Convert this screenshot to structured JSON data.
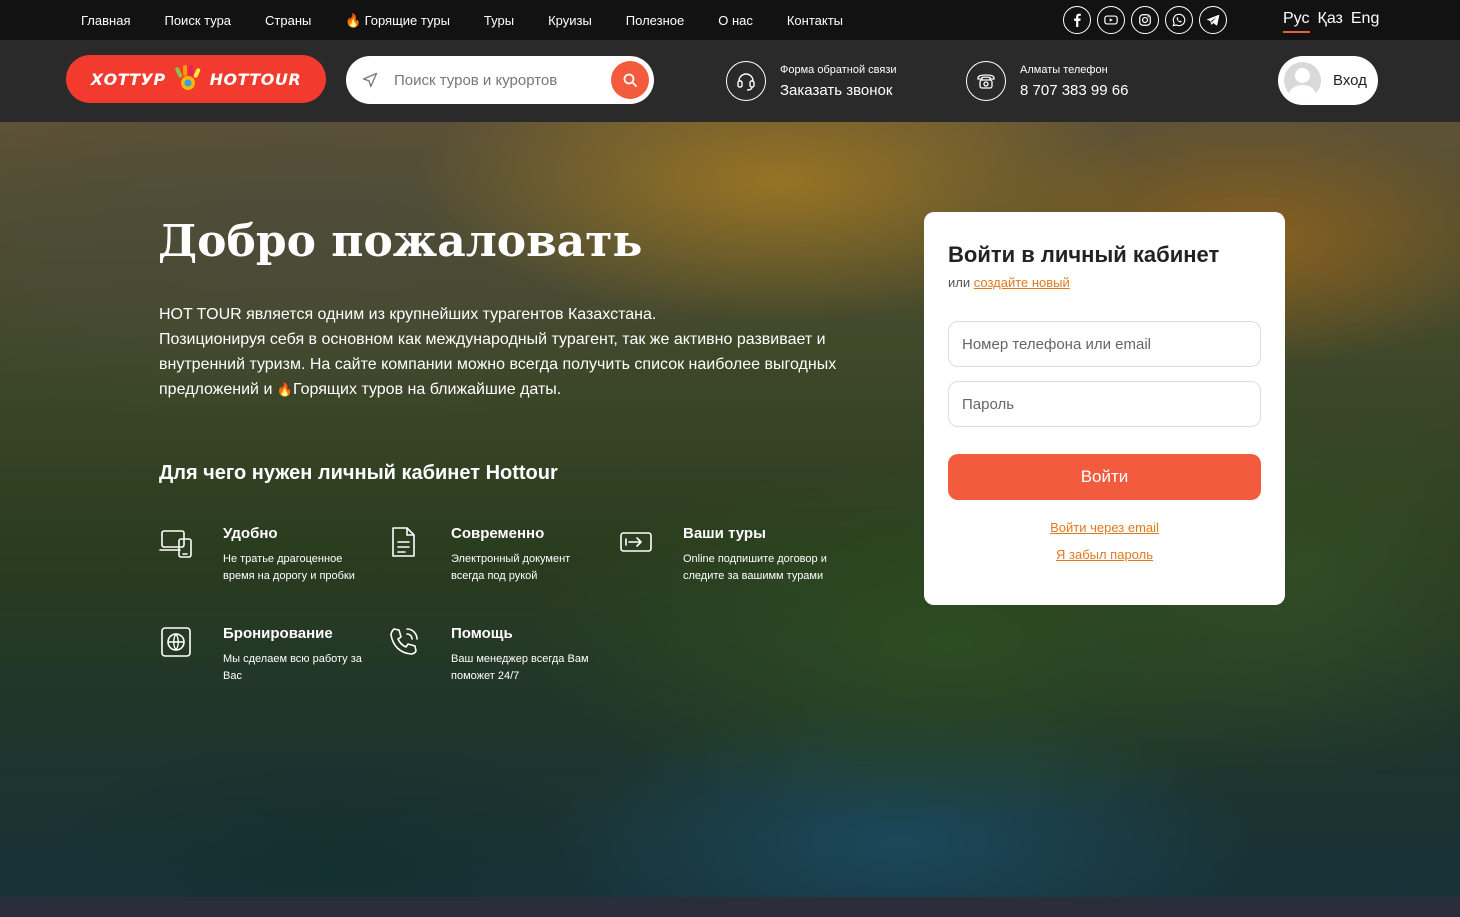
{
  "nav": {
    "items": [
      "Главная",
      "Поиск тура",
      "Страны",
      "Горящие туры",
      "Туры",
      "Круизы",
      "Полезное",
      "О нас",
      "Контакты"
    ],
    "socials": [
      "facebook-icon",
      "youtube-icon",
      "instagram-icon",
      "whatsapp-icon",
      "telegram-icon"
    ],
    "languages": [
      "Рус",
      "Қаз",
      "Eng"
    ],
    "active_language": "Рус"
  },
  "header": {
    "logo_left": "ХОТТУР",
    "logo_right": "HOTTOUR",
    "search_placeholder": "Поиск туров и курортов",
    "callback_label": "Форма обратной связи",
    "callback_action": "Заказать звонок",
    "phone_label": "Алматы телефон",
    "phone_number": "8 707 383 99 66",
    "login_label": "Вход"
  },
  "hero": {
    "title": "Добро пожаловать",
    "intro": "HOT TOUR является одним из крупнейших турагентов Казахстана.\nПозиционируя себя в основном как международный турагент, так же активно развивает и внутренний туризм. На сайте компании можно всегда получить список наиболее выгодных предложений и ",
    "intro_link": "Горящих туров на ближайшие даты.",
    "why_title": "Для чего нужен личный кабинет Hottour",
    "features": [
      {
        "title": "Удобно",
        "desc": "Не тратье драгоценное время на дорогу и пробки",
        "icon": "devices-icon"
      },
      {
        "title": "Современно",
        "desc": "Электронный документ всегда под рукой",
        "icon": "document-icon"
      },
      {
        "title": "Ваши туры",
        "desc": "Online подпишите договор и следите за вашимм турами",
        "icon": "flight-ticket-icon"
      },
      {
        "title": "Бронирование",
        "desc": "Мы сделаем всю работу за Вас",
        "icon": "globe-booking-icon"
      },
      {
        "title": "Помощь",
        "desc": "Ваш менеджер всегда Вам поможет 24/7",
        "icon": "phone-support-icon"
      }
    ]
  },
  "login": {
    "title": "Войти в личный кабинет",
    "or_text": "или",
    "create_link": "создайте новый",
    "phone_placeholder": "Номер телефона или email",
    "password_placeholder": "Пароль",
    "submit_label": "Войти",
    "email_login_link": "Войти через email",
    "forgot_link": "Я забыл пароль"
  },
  "colors": {
    "accent": "#f35b3f",
    "link": "#e07a1f",
    "topbar": "#121212",
    "headerbar": "#2a2a2a"
  }
}
